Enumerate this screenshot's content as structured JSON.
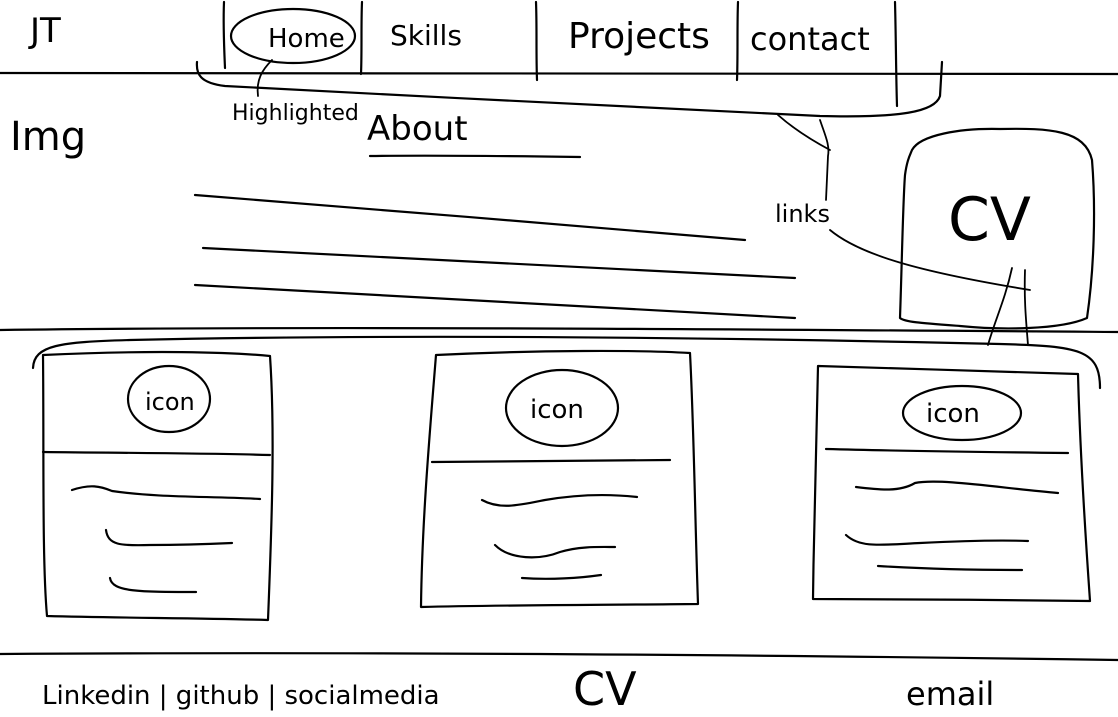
{
  "logo": "JT",
  "nav": {
    "items": [
      {
        "label": "Home"
      },
      {
        "label": "Skills"
      },
      {
        "label": "Projects"
      },
      {
        "label": "contact"
      }
    ]
  },
  "annotations": {
    "highlighted": "Highlighted",
    "links": "links"
  },
  "hero": {
    "image_label": "Img",
    "heading": "About",
    "cv_label": "CV"
  },
  "cards": [
    {
      "icon_label": "icon"
    },
    {
      "icon_label": "icon"
    },
    {
      "icon_label": "icon"
    }
  ],
  "footer": {
    "socials": "Linkedin | github | socialmedia",
    "cv": "CV",
    "email": "email"
  }
}
